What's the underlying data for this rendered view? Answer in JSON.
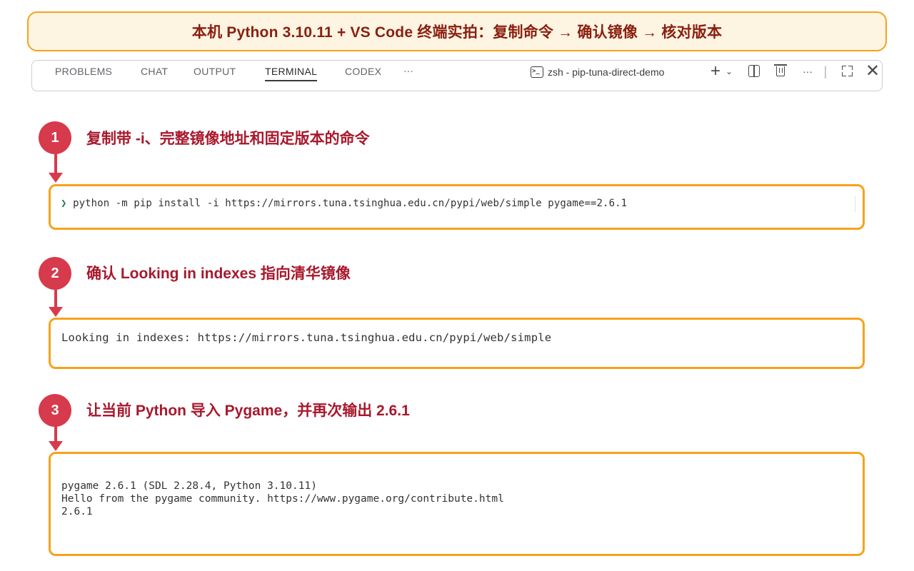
{
  "banner": {
    "title": "本机 Python 3.10.11 + VS Code 终端实拍：复制命令 → 确认镜像 → 核对版本"
  },
  "panel": {
    "tabs": [
      {
        "label": "PROBLEMS",
        "active": false
      },
      {
        "label": "CHAT",
        "active": false
      },
      {
        "label": "OUTPUT",
        "active": false
      },
      {
        "label": "TERMINAL",
        "active": true
      },
      {
        "label": "CODEX",
        "active": false
      }
    ],
    "more_label": "···",
    "terminal_name": "zsh - pip-tuna-direct-demo",
    "toolbar": {
      "new_terminal_icon": "plus-icon",
      "dropdown_icon": "chevron-down-icon",
      "split_icon": "split-terminal-icon",
      "kill_icon": "trash-icon",
      "more_icon": "ellipsis-icon",
      "maximize_icon": "maximize-icon",
      "close_icon": "close-icon"
    }
  },
  "colors": {
    "accent_orange": "#f7a21b",
    "step_red": "#d63a4c",
    "banner_bg": "#fdf4e2",
    "banner_text": "#8a1f0f",
    "label_text": "#a8182c"
  },
  "steps": [
    {
      "number": "1",
      "label": "复制带 -i、完整镜像地址和固定版本的命令",
      "prompt": "❯",
      "command": "python -m pip install -i https://mirrors.tuna.tsinghua.edu.cn/pypi/web/simple pygame==2.6.1"
    },
    {
      "number": "2",
      "label": "确认 Looking in indexes 指向清华镜像",
      "output": "Looking in indexes: https://mirrors.tuna.tsinghua.edu.cn/pypi/web/simple"
    },
    {
      "number": "3",
      "label": "让当前 Python 导入 Pygame，并再次输出 2.6.1",
      "output_lines": [
        "pygame 2.6.1 (SDL 2.28.4, Python 3.10.11)",
        "Hello from the pygame community. https://www.pygame.org/contribute.html",
        "2.6.1"
      ]
    }
  ]
}
